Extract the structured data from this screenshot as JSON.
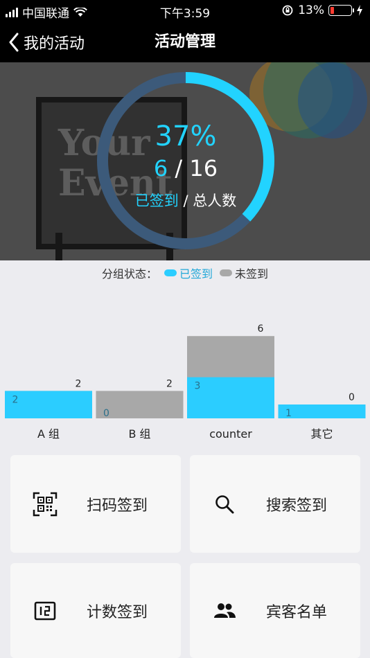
{
  "status_bar": {
    "carrier": "中国联通",
    "time": "下午3:59",
    "battery": "13%"
  },
  "nav": {
    "back_label": "我的活动",
    "title": "活动管理"
  },
  "hero": {
    "image_text": "Your Event",
    "percent": "37%",
    "signed": "6",
    "separator": "/",
    "total": "16",
    "signed_label": "已签到",
    "label_separator": "/",
    "total_label": "总人数",
    "progress": 0.37
  },
  "legend": {
    "prefix": "分组状态：",
    "signed": "已签到",
    "unsigned": "未签到"
  },
  "chart_data": {
    "type": "bar",
    "categories": [
      "A 组",
      "B  组",
      "counter",
      "其它"
    ],
    "series": [
      {
        "name": "已签到",
        "values": [
          2,
          0,
          3,
          1
        ],
        "color": "#2bcdff"
      },
      {
        "name": "未签到",
        "values": [
          2,
          2,
          6,
          0
        ],
        "color": "#a8a8a8"
      }
    ],
    "ylim": [
      0,
      6
    ],
    "legend": "top-center",
    "grid": false
  },
  "actions": [
    {
      "label": "扫码签到",
      "icon": "qr-code-icon"
    },
    {
      "label": "搜索签到",
      "icon": "search-icon"
    },
    {
      "label": "计数签到",
      "icon": "counter-icon"
    },
    {
      "label": "宾客名单",
      "icon": "people-icon"
    }
  ],
  "colors": {
    "accent": "#22d3ff",
    "ring_track": "#3c5a7a",
    "signed_bar": "#2bcdff",
    "unsigned_bar": "#a8a8a8"
  }
}
